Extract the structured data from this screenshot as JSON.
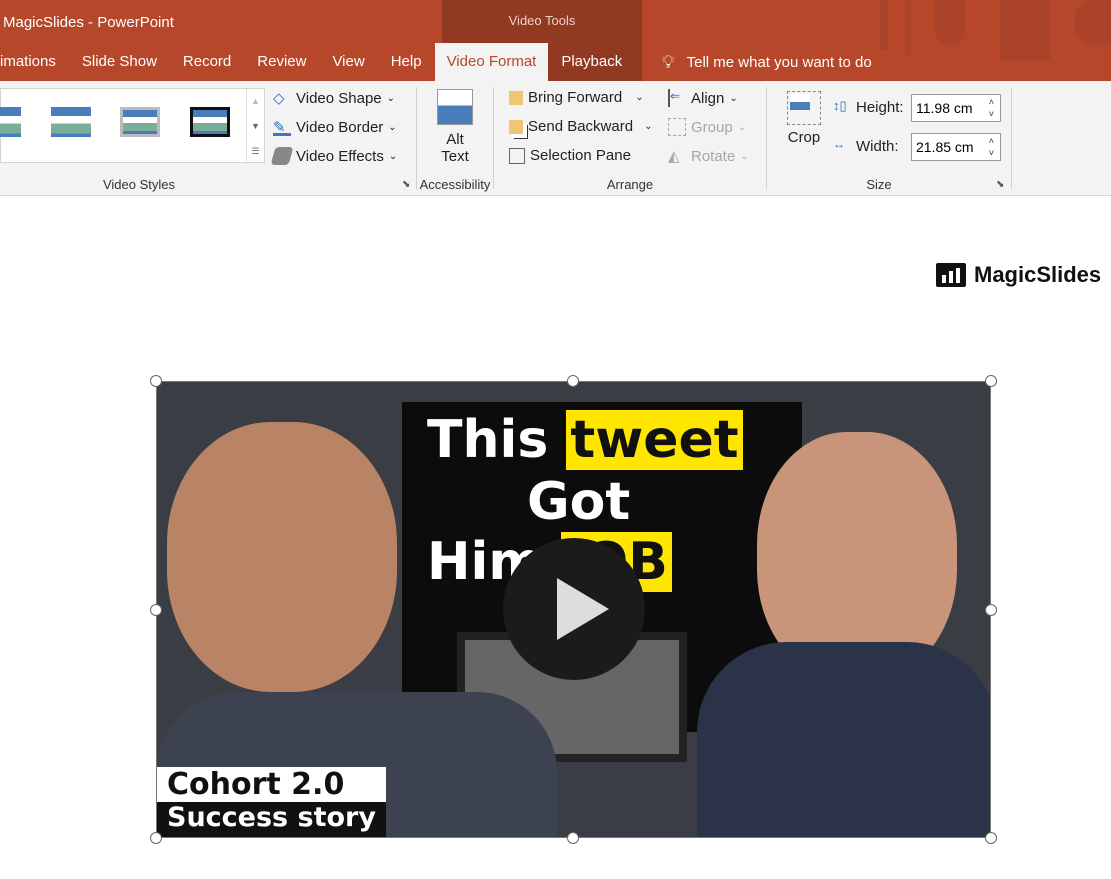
{
  "window": {
    "title": "MagicSlides  -  PowerPoint",
    "context_group": "Video Tools"
  },
  "tabs": [
    {
      "label": "imations"
    },
    {
      "label": "Slide Show"
    },
    {
      "label": "Record"
    },
    {
      "label": "Review"
    },
    {
      "label": "View"
    },
    {
      "label": "Help"
    },
    {
      "label": "Video Format",
      "active": true
    },
    {
      "label": "Playback"
    }
  ],
  "tell_me": "Tell me what you want to do",
  "ribbon": {
    "video_styles": {
      "label": "Video Styles",
      "shape": "Video Shape",
      "border": "Video Border",
      "effects": "Video Effects"
    },
    "accessibility": {
      "label": "Accessibility",
      "alt_text_1": "Alt",
      "alt_text_2": "Text"
    },
    "arrange": {
      "label": "Arrange",
      "bring_forward": "Bring Forward",
      "send_backward": "Send Backward",
      "selection_pane": "Selection Pane",
      "align": "Align",
      "group": "Group",
      "rotate": "Rotate"
    },
    "size": {
      "label": "Size",
      "crop": "Crop",
      "height_label": "Height:",
      "height_value": "11.98 cm",
      "width_label": "Width:",
      "width_value": "21.85 cm"
    }
  },
  "slide": {
    "logo": "MagicSlides",
    "video": {
      "line1a": "This",
      "line1b": "tweet",
      "line2": "Got",
      "line3a": "Him",
      "line3b": "JOB",
      "cohort1": "Cohort 2.0",
      "cohort2": "Success story"
    }
  },
  "colors": {
    "brand": "#b7472a",
    "context": "#923922"
  }
}
